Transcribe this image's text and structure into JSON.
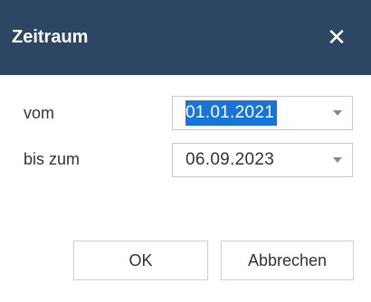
{
  "dialog": {
    "title": "Zeitraum",
    "close_glyph": "✕",
    "close_icon": "close-icon"
  },
  "fields": {
    "from": {
      "label": "vom",
      "value": "01.01.2021",
      "selected": true
    },
    "to": {
      "label": "bis zum",
      "value": "06.09.2023"
    }
  },
  "buttons": {
    "ok": "OK",
    "cancel": "Abbrechen"
  },
  "colors": {
    "titlebar": "#2c4664",
    "selection": "#1874d6"
  }
}
